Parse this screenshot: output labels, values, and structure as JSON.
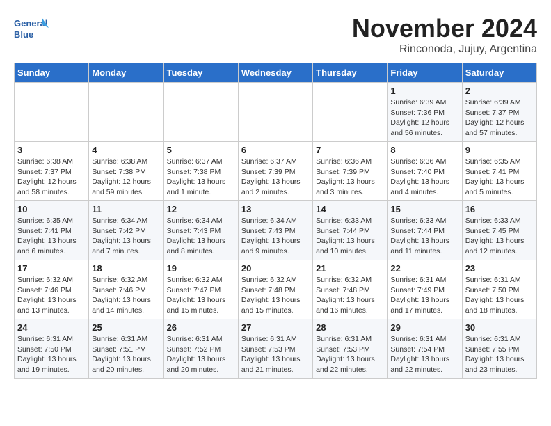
{
  "logo": {
    "line1": "General",
    "line2": "Blue"
  },
  "title": "November 2024",
  "location": "Rinconoda, Jujuy, Argentina",
  "weekdays": [
    "Sunday",
    "Monday",
    "Tuesday",
    "Wednesday",
    "Thursday",
    "Friday",
    "Saturday"
  ],
  "weeks": [
    [
      {
        "day": "",
        "info": ""
      },
      {
        "day": "",
        "info": ""
      },
      {
        "day": "",
        "info": ""
      },
      {
        "day": "",
        "info": ""
      },
      {
        "day": "",
        "info": ""
      },
      {
        "day": "1",
        "info": "Sunrise: 6:39 AM\nSunset: 7:36 PM\nDaylight: 12 hours\nand 56 minutes."
      },
      {
        "day": "2",
        "info": "Sunrise: 6:39 AM\nSunset: 7:37 PM\nDaylight: 12 hours\nand 57 minutes."
      }
    ],
    [
      {
        "day": "3",
        "info": "Sunrise: 6:38 AM\nSunset: 7:37 PM\nDaylight: 12 hours\nand 58 minutes."
      },
      {
        "day": "4",
        "info": "Sunrise: 6:38 AM\nSunset: 7:38 PM\nDaylight: 12 hours\nand 59 minutes."
      },
      {
        "day": "5",
        "info": "Sunrise: 6:37 AM\nSunset: 7:38 PM\nDaylight: 13 hours\nand 1 minute."
      },
      {
        "day": "6",
        "info": "Sunrise: 6:37 AM\nSunset: 7:39 PM\nDaylight: 13 hours\nand 2 minutes."
      },
      {
        "day": "7",
        "info": "Sunrise: 6:36 AM\nSunset: 7:39 PM\nDaylight: 13 hours\nand 3 minutes."
      },
      {
        "day": "8",
        "info": "Sunrise: 6:36 AM\nSunset: 7:40 PM\nDaylight: 13 hours\nand 4 minutes."
      },
      {
        "day": "9",
        "info": "Sunrise: 6:35 AM\nSunset: 7:41 PM\nDaylight: 13 hours\nand 5 minutes."
      }
    ],
    [
      {
        "day": "10",
        "info": "Sunrise: 6:35 AM\nSunset: 7:41 PM\nDaylight: 13 hours\nand 6 minutes."
      },
      {
        "day": "11",
        "info": "Sunrise: 6:34 AM\nSunset: 7:42 PM\nDaylight: 13 hours\nand 7 minutes."
      },
      {
        "day": "12",
        "info": "Sunrise: 6:34 AM\nSunset: 7:43 PM\nDaylight: 13 hours\nand 8 minutes."
      },
      {
        "day": "13",
        "info": "Sunrise: 6:34 AM\nSunset: 7:43 PM\nDaylight: 13 hours\nand 9 minutes."
      },
      {
        "day": "14",
        "info": "Sunrise: 6:33 AM\nSunset: 7:44 PM\nDaylight: 13 hours\nand 10 minutes."
      },
      {
        "day": "15",
        "info": "Sunrise: 6:33 AM\nSunset: 7:44 PM\nDaylight: 13 hours\nand 11 minutes."
      },
      {
        "day": "16",
        "info": "Sunrise: 6:33 AM\nSunset: 7:45 PM\nDaylight: 13 hours\nand 12 minutes."
      }
    ],
    [
      {
        "day": "17",
        "info": "Sunrise: 6:32 AM\nSunset: 7:46 PM\nDaylight: 13 hours\nand 13 minutes."
      },
      {
        "day": "18",
        "info": "Sunrise: 6:32 AM\nSunset: 7:46 PM\nDaylight: 13 hours\nand 14 minutes."
      },
      {
        "day": "19",
        "info": "Sunrise: 6:32 AM\nSunset: 7:47 PM\nDaylight: 13 hours\nand 15 minutes."
      },
      {
        "day": "20",
        "info": "Sunrise: 6:32 AM\nSunset: 7:48 PM\nDaylight: 13 hours\nand 15 minutes."
      },
      {
        "day": "21",
        "info": "Sunrise: 6:32 AM\nSunset: 7:48 PM\nDaylight: 13 hours\nand 16 minutes."
      },
      {
        "day": "22",
        "info": "Sunrise: 6:31 AM\nSunset: 7:49 PM\nDaylight: 13 hours\nand 17 minutes."
      },
      {
        "day": "23",
        "info": "Sunrise: 6:31 AM\nSunset: 7:50 PM\nDaylight: 13 hours\nand 18 minutes."
      }
    ],
    [
      {
        "day": "24",
        "info": "Sunrise: 6:31 AM\nSunset: 7:50 PM\nDaylight: 13 hours\nand 19 minutes."
      },
      {
        "day": "25",
        "info": "Sunrise: 6:31 AM\nSunset: 7:51 PM\nDaylight: 13 hours\nand 20 minutes."
      },
      {
        "day": "26",
        "info": "Sunrise: 6:31 AM\nSunset: 7:52 PM\nDaylight: 13 hours\nand 20 minutes."
      },
      {
        "day": "27",
        "info": "Sunrise: 6:31 AM\nSunset: 7:53 PM\nDaylight: 13 hours\nand 21 minutes."
      },
      {
        "day": "28",
        "info": "Sunrise: 6:31 AM\nSunset: 7:53 PM\nDaylight: 13 hours\nand 22 minutes."
      },
      {
        "day": "29",
        "info": "Sunrise: 6:31 AM\nSunset: 7:54 PM\nDaylight: 13 hours\nand 22 minutes."
      },
      {
        "day": "30",
        "info": "Sunrise: 6:31 AM\nSunset: 7:55 PM\nDaylight: 13 hours\nand 23 minutes."
      }
    ]
  ]
}
